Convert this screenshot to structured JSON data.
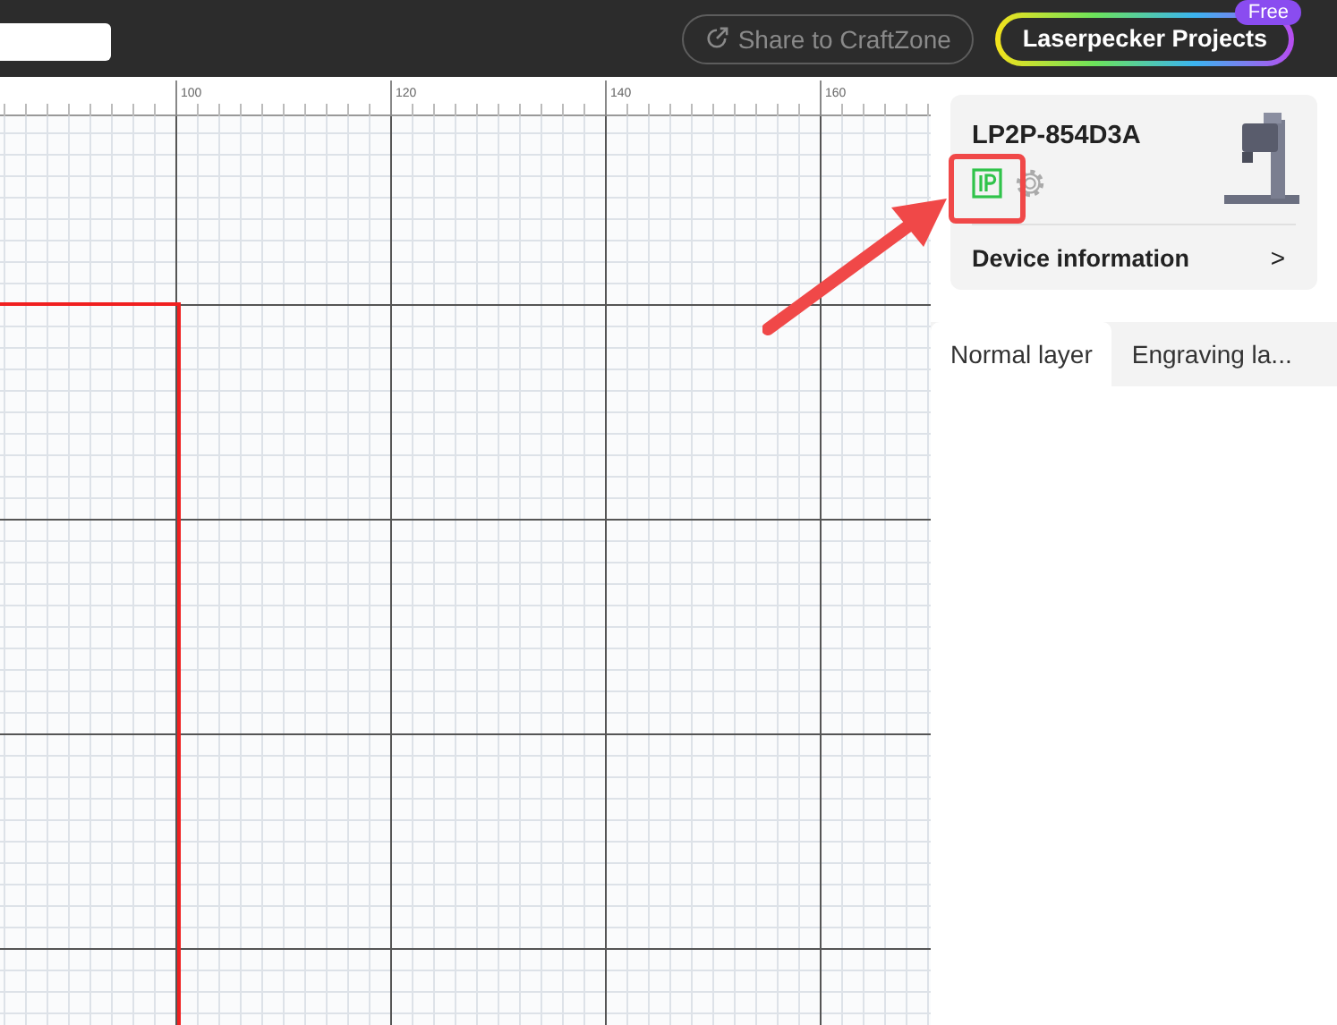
{
  "top_bar": {
    "share_button": {
      "label": "Share to CraftZone",
      "disabled": true
    },
    "projects_button": {
      "label": "Laserpecker Projects",
      "badge": "Free"
    }
  },
  "ruler": {
    "labels": [
      "100",
      "120",
      "140",
      "160"
    ]
  },
  "device_card": {
    "name": "LP2P-854D3A",
    "info_label": "Device information",
    "chevron": ">"
  },
  "layer_tabs": [
    {
      "label": "Normal layer",
      "selected": true
    },
    {
      "label": "Engraving la...",
      "selected": false
    }
  ]
}
